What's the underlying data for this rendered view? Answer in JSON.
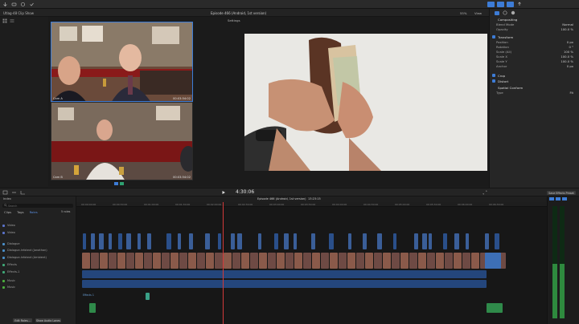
{
  "app": {
    "library_title": "Utlag-48 Clip Show",
    "project_title": "Episode 466 (Android, 1st version)",
    "timecode": "4:30:06",
    "topbar_right_label": "AddedCourt_13022078",
    "topbar_right_time": "0:40"
  },
  "viewer": {
    "zoom": "55%",
    "view_label": "View",
    "settings_label": "Settings",
    "angles": [
      {
        "label": "Cam A",
        "timecode": "00:03:54:02"
      },
      {
        "label": "Cam B",
        "timecode": "00:03:54:02"
      }
    ]
  },
  "inspector": {
    "sections": {
      "compositing": "Compositing",
      "transform": "Transform",
      "crop": "Crop",
      "distort": "Distort",
      "spatial": "Spatial Conform"
    },
    "compositing_rows": [
      {
        "key": "Blend Mode",
        "value": "Normal"
      },
      {
        "key": "Opacity",
        "value": "100.0 %"
      }
    ],
    "transform_rows": [
      {
        "key": "Position",
        "value": "0 px"
      },
      {
        "key": "Rotation",
        "value": "0 °"
      },
      {
        "key": "Scale (All)",
        "value": "100 %"
      },
      {
        "key": "Scale X",
        "value": "100.0 %"
      },
      {
        "key": "Scale Y",
        "value": "100.0 %"
      },
      {
        "key": "Anchor",
        "value": "0 px"
      }
    ],
    "spatial_row": {
      "key": "Type",
      "value": "Fit"
    }
  },
  "timeline_bar": {
    "timecode": "4:30:06",
    "clip_name": "Episode 466 (Android, 1st version)",
    "duration": "13:23:15",
    "button_right": "Save Effects Preset"
  },
  "sidebar": {
    "title": "Index",
    "search_placeholder": "Search",
    "tabs": [
      "Clips",
      "Tags",
      "Roles"
    ],
    "count_label": "5 roles",
    "items": [
      {
        "label": "Video",
        "color": "#5a72c9"
      },
      {
        "label": "Video",
        "color": "#5a72c9"
      },
      {
        "label": "Dialogue",
        "color": "#4a8fc9"
      },
      {
        "label": "Dialogue-Infotext (Jonathan)",
        "color": "#4a8fc9"
      },
      {
        "label": "Dialogue-Infotext (Ambient)",
        "color": "#4a8fc9"
      },
      {
        "label": "Effects",
        "color": "#3fa877"
      },
      {
        "label": "Effects-1",
        "color": "#3fa877"
      },
      {
        "label": "Music",
        "color": "#4cae3e"
      },
      {
        "label": "Music",
        "color": "#4cae3e"
      }
    ],
    "footer_buttons": [
      "Edit Roles...",
      "Show Audio Lanes"
    ]
  },
  "ruler": {
    "ticks": [
      "00:00:00:00",
      "00:00:30:00",
      "00:01:00:00",
      "00:01:30:00",
      "00:02:00:00",
      "00:02:30:00",
      "00:03:00:00",
      "00:03:30:00",
      "00:04:00:00",
      "00:04:30:00",
      "00:05:00:00",
      "00:05:30:00",
      "00:06:00:00",
      "00:06:30:00"
    ]
  },
  "timeline": {
    "effects_label": "Effects 1"
  },
  "colors": {
    "accent": "#3d7cd6",
    "playhead": "#d23a3a",
    "audio": "#2c4f86",
    "music": "#2f8a4a"
  }
}
